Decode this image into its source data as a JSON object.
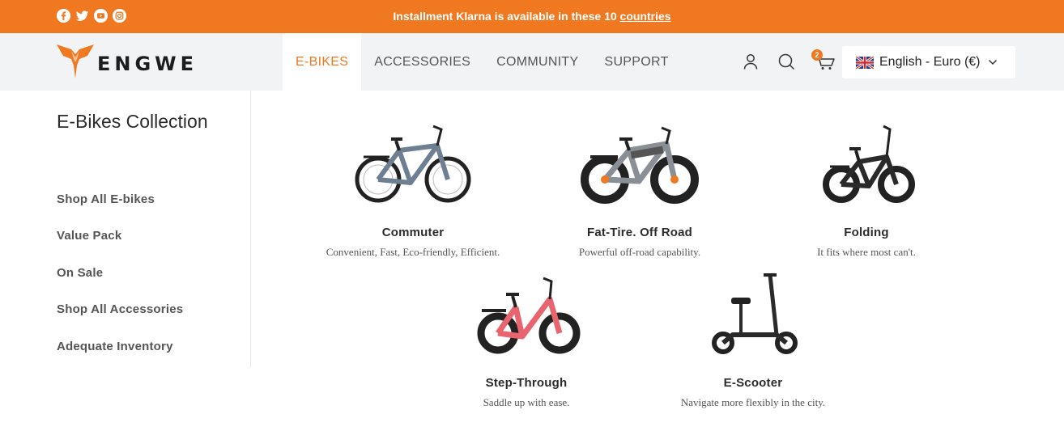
{
  "topbar": {
    "announcement_prefix": "Installment Klarna is available in these 10 ",
    "announcement_link": "countries",
    "social": [
      "facebook-icon",
      "twitter-icon",
      "youtube-icon",
      "instagram-icon"
    ]
  },
  "header": {
    "logo_text": "ENGWE",
    "nav": [
      {
        "label": "E-BIKES",
        "active": true
      },
      {
        "label": "ACCESSORIES",
        "active": false
      },
      {
        "label": "COMMUNITY",
        "active": false
      },
      {
        "label": "SUPPORT",
        "active": false
      }
    ],
    "cart_count": "2",
    "language": "English - Euro (€)"
  },
  "sidebar": {
    "title": "E-Bikes Collection",
    "links": [
      "Shop All E-bikes",
      "Value Pack",
      "On Sale",
      "Shop All Accessories",
      "Adequate Inventory"
    ]
  },
  "products": [
    {
      "name": "Commuter",
      "description": "Convenient, Fast, Eco-friendly, Efficient."
    },
    {
      "name": "Fat-Tire. Off Road",
      "description": "Powerful off-road capability."
    },
    {
      "name": "Folding",
      "description": "It fits where most can't."
    },
    {
      "name": "Step-Through",
      "description": "Saddle up with ease."
    },
    {
      "name": "E-Scooter",
      "description": "Navigate more flexibly in the city."
    }
  ],
  "colors": {
    "accent": "#f07821",
    "header_bg": "#f2f3f5",
    "commuter_frame": "#6f7f92",
    "fat_tire_frame": "#8a8f96",
    "folding_frame": "#2a2a2a",
    "step_through_frame": "#e8656f",
    "scooter_frame": "#2a2a2a"
  }
}
